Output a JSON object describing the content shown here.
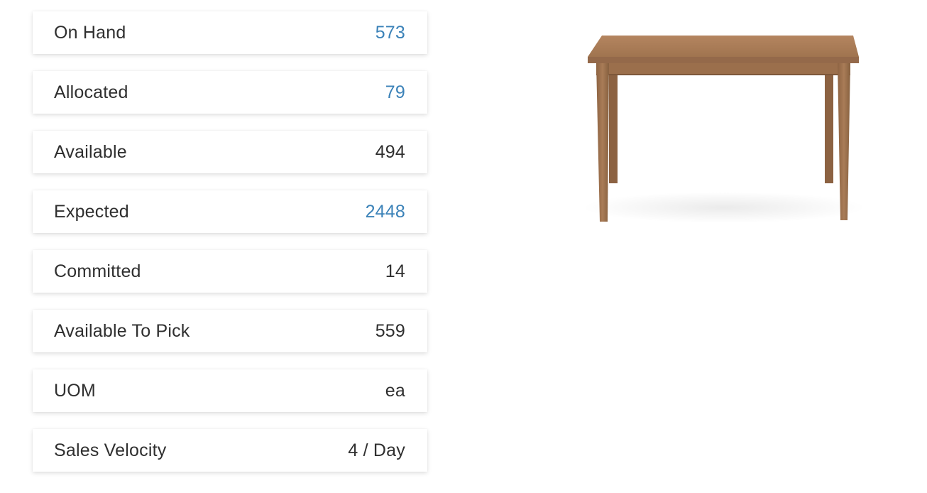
{
  "inventory": {
    "rows": [
      {
        "label": "On Hand",
        "value": "573",
        "link": true
      },
      {
        "label": "Allocated",
        "value": "79",
        "link": true
      },
      {
        "label": "Available",
        "value": "494",
        "link": false
      },
      {
        "label": "Expected",
        "value": "2448",
        "link": true
      },
      {
        "label": "Committed",
        "value": "14",
        "link": false
      },
      {
        "label": "Available To Pick",
        "value": "559",
        "link": false
      },
      {
        "label": "UOM",
        "value": "ea",
        "link": false
      },
      {
        "label": "Sales Velocity",
        "value": "4 / Day",
        "link": false
      }
    ]
  },
  "colors": {
    "link": "#3b82b8",
    "text": "#2f2f2f",
    "wood": "#a87b58"
  },
  "product_image": {
    "icon": "wooden-table-image"
  }
}
